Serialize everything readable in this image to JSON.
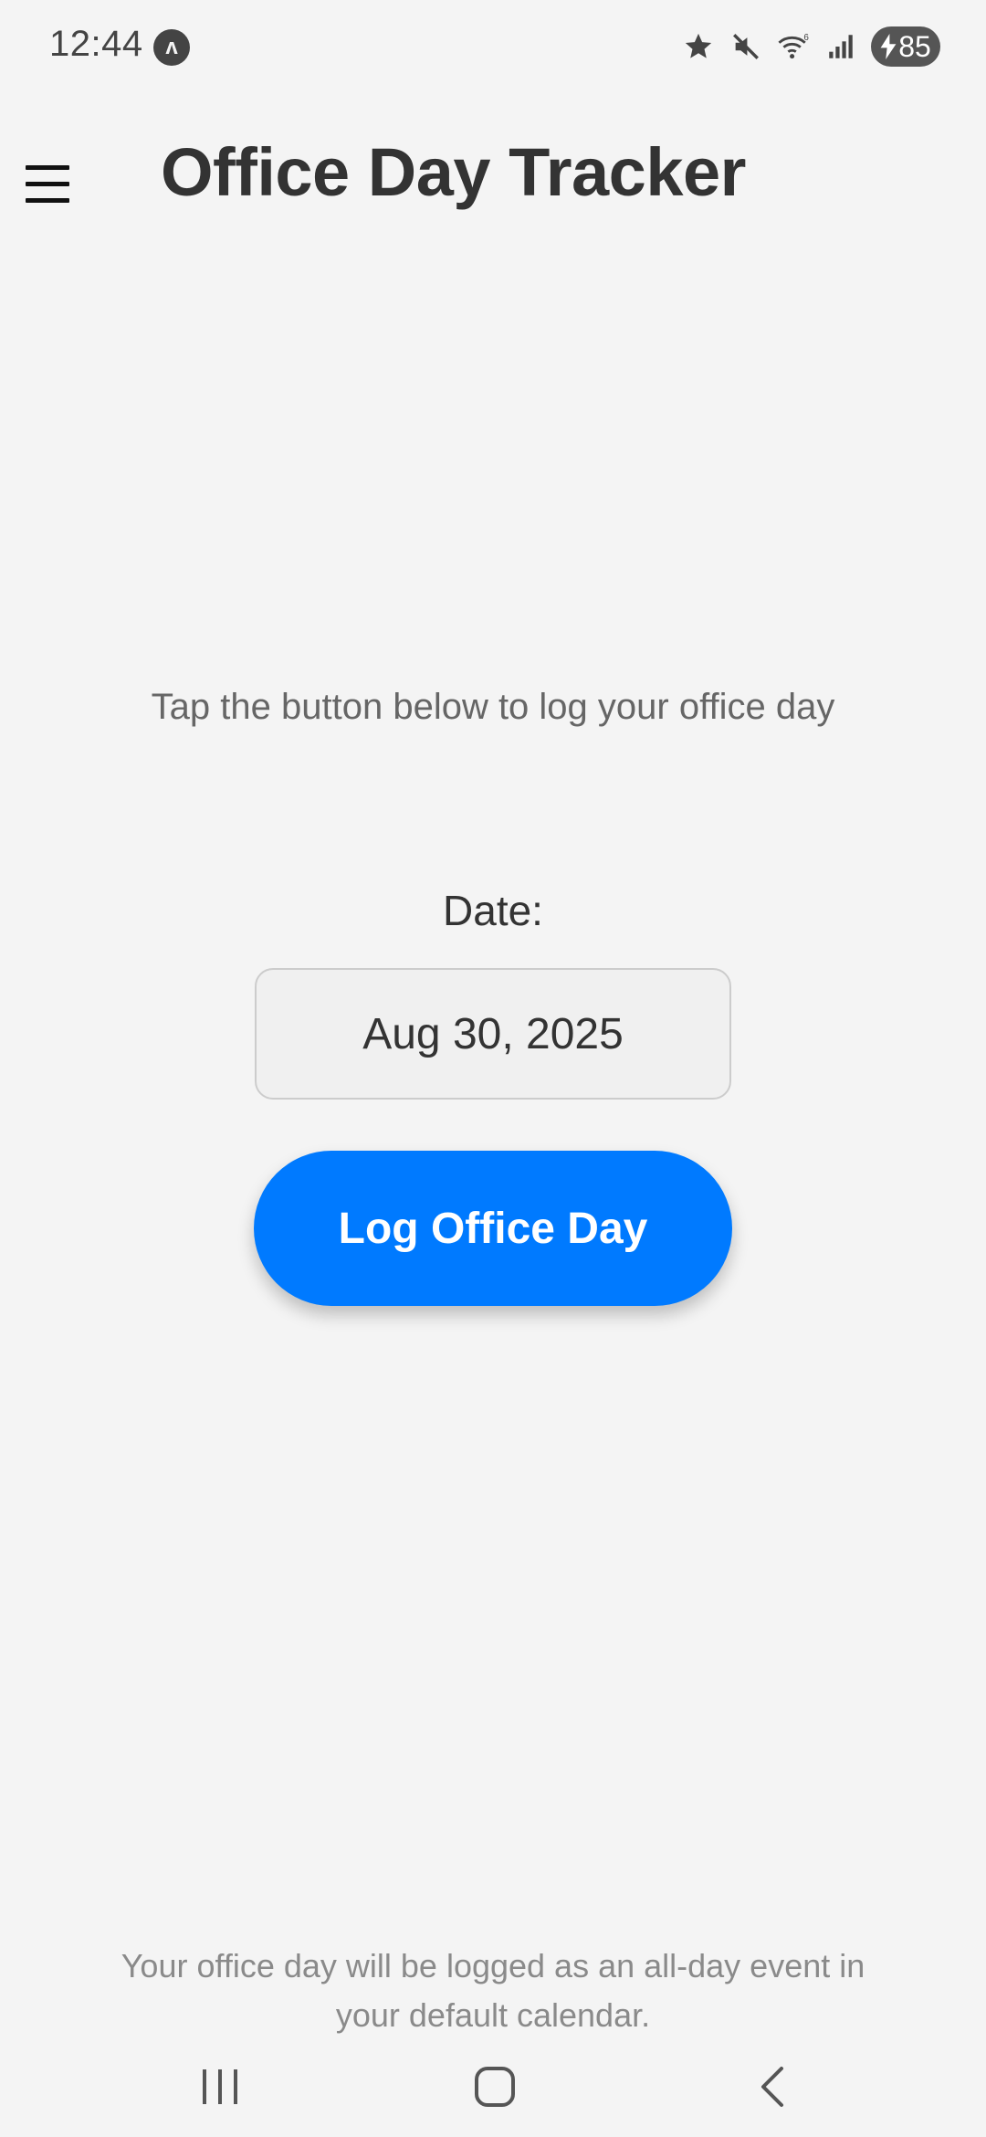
{
  "status_bar": {
    "time": "12:44",
    "app_icon_glyph": "ʌ",
    "icons": [
      "star-icon",
      "mute-icon",
      "wifi-icon",
      "signal-icon"
    ],
    "battery_level": "85"
  },
  "header": {
    "title": "Office Day Tracker",
    "menu_icon": "hamburger-menu-icon"
  },
  "main": {
    "instruction": "Tap the button below to log your office day",
    "date_label": "Date:",
    "date_value": "Aug 30, 2025",
    "log_button_label": "Log Office Day"
  },
  "footer": {
    "note": "Your office day will be logged as an all-day event in your default calendar."
  },
  "nav_bar": {
    "buttons": [
      "recent-apps-icon",
      "home-icon",
      "back-icon"
    ]
  },
  "colors": {
    "background": "#f4f4f4",
    "accent": "#007aff",
    "title_text": "#333333",
    "muted_text": "#8a8a8a"
  }
}
